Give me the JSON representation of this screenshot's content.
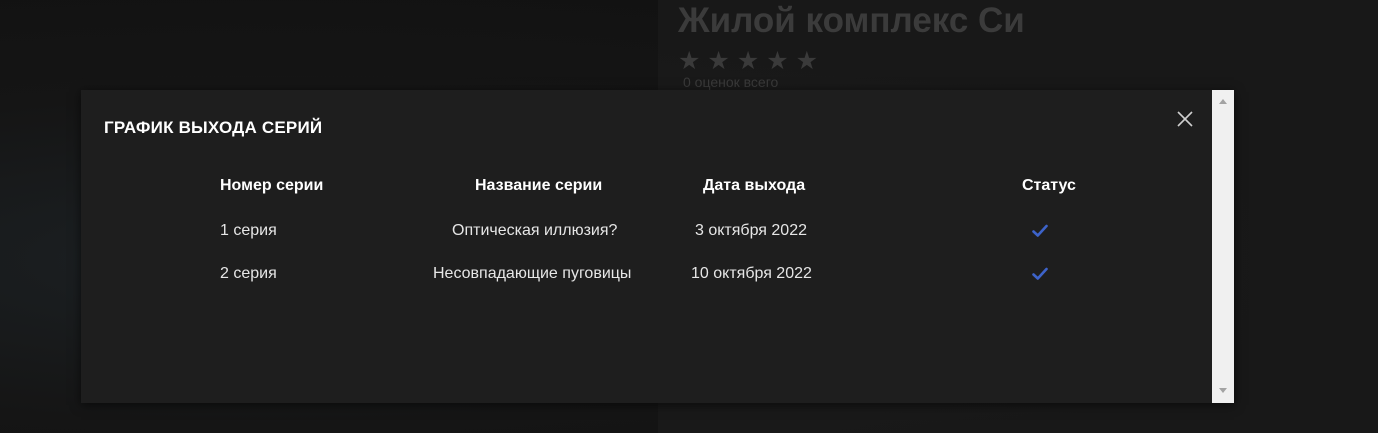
{
  "background": {
    "title": "Жилой комплекс Си",
    "stars": "★★★★★",
    "ratings_text": "0 оценок всего"
  },
  "modal": {
    "title": "ГРАФИК ВЫХОДА СЕРИЙ",
    "close_icon": "close-icon",
    "table": {
      "headers": {
        "number": "Номер серии",
        "name": "Название серии",
        "date": "Дата выхода",
        "status": "Статус"
      },
      "rows": [
        {
          "number": "1 серия",
          "name": "Оптическая иллюзия?",
          "date": "3 октября 2022",
          "status_icon": "check-icon"
        },
        {
          "number": "2 серия",
          "name": "Несовпадающие пуговицы",
          "date": "10 октября 2022",
          "status_icon": "check-icon"
        }
      ]
    }
  },
  "colors": {
    "modal_bg": "#1e1e1e",
    "check": "#3d63c9",
    "scrollbar": "#f0f0f0"
  }
}
